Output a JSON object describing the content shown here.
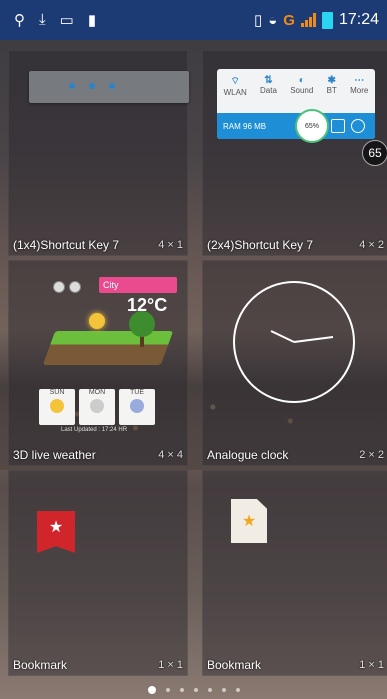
{
  "status_bar": {
    "icons_left": [
      "usb-icon",
      "download-icon",
      "screenshot-icon",
      "sd-card-icon"
    ],
    "network": "G",
    "time": "17:24"
  },
  "widgets": [
    {
      "name": "(1x4)Shortcut Key 7",
      "size": "4 × 1"
    },
    {
      "name": "(2x4)Shortcut Key 7",
      "size": "4 × 2"
    },
    {
      "name": "3D live weather",
      "size": "4 × 4"
    },
    {
      "name": "Analogue clock",
      "size": "2 × 2"
    },
    {
      "name": "Bookmark",
      "size": "1 × 1"
    },
    {
      "name": "Bookmark",
      "size": "1 × 1"
    }
  ],
  "badge_count": "65",
  "weather_preview": {
    "city": "City",
    "temp": "12°C",
    "days": [
      "SUN",
      "MON",
      "TUE"
    ],
    "footer": "Last Updated : 17:24 HR"
  },
  "pager": {
    "pages": 7,
    "current": 0
  },
  "colors": {
    "status_bar": "#1c3a74",
    "network": "#f08a18",
    "battery": "#2ad5f2"
  }
}
